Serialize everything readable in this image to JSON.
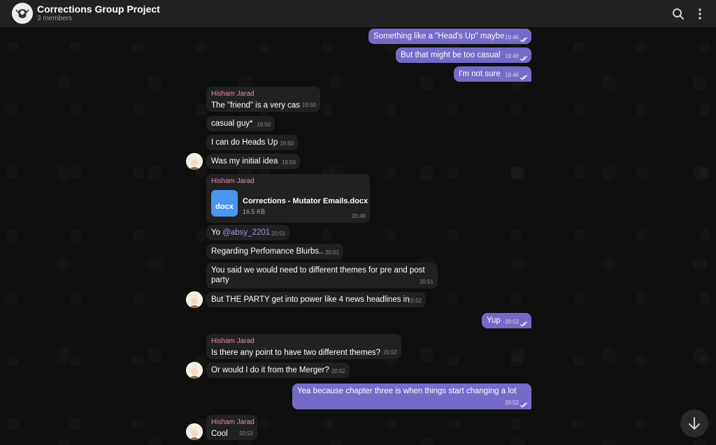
{
  "header": {
    "title": "Corrections Group Project",
    "members": "3 members"
  },
  "messages": {
    "m1": {
      "text": "Something like a \"Head's Up\" maybe",
      "time": "19:46"
    },
    "m2": {
      "text": "But that might be too casual",
      "time": "19:46"
    },
    "m3": {
      "text": "I'm not sure",
      "time": "19:46"
    },
    "m4": {
      "sender": "Hisham Jarad",
      "text": "The \"friend\" is a very cas",
      "time": "19:50"
    },
    "m5": {
      "text": "casual guy*",
      "time": "19:50"
    },
    "m6": {
      "text": "I can do Heads Up",
      "time": "19:50"
    },
    "m7": {
      "text": "Was my initial idea",
      "time": "19:50"
    },
    "m8": {
      "sender": "Hisham Jarad",
      "file_type": "docx",
      "file_name": "Corrections - Mutator Emails.docx",
      "file_size": "16.5 KB",
      "time": "20:49"
    },
    "m9": {
      "text": "Yo ",
      "mention": "@absy_2201",
      "time": "20:51"
    },
    "m10": {
      "text": "Regarding Perfomance Blurbs..",
      "time": "20:51"
    },
    "m11": {
      "line1": "You said we would need to different themes for pre and post",
      "line2": "party",
      "time": "20:51"
    },
    "m12": {
      "text": "But THE PARTY get into power like 4 news headlines in",
      "time": "20:52"
    },
    "m13": {
      "text": "Yup",
      "time": "20:52"
    },
    "m14": {
      "sender": "Hisham Jarad",
      "text": "Is there any point to have two different themes?",
      "time": "20:52"
    },
    "m15": {
      "text": "Or would I do it from the Merger?",
      "time": "20:52"
    },
    "m16": {
      "text": "Yea because chapter three is when things start changing a lot",
      "time": "20:52"
    },
    "m17": {
      "sender": "Hisham Jarad",
      "text": "Cool",
      "time": "20:53"
    }
  },
  "colors": {
    "outgoing": "#766ac8",
    "incoming": "#212121",
    "sender_name": "#e88ab3",
    "header": "#212121"
  },
  "icons": [
    "group-avatar-icon",
    "search-icon",
    "more-vertical-icon",
    "double-check-icon",
    "scroll-down-icon"
  ]
}
